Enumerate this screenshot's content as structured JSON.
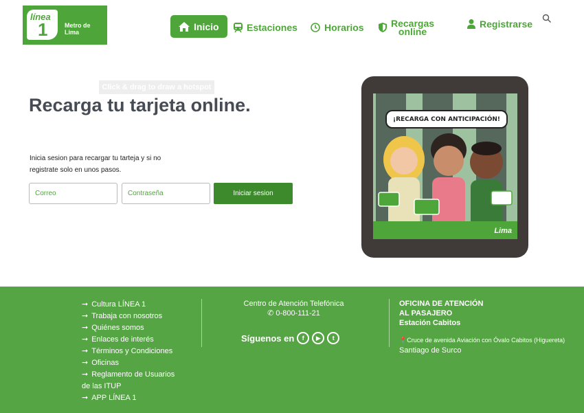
{
  "logo": {
    "linea": "línea",
    "number": "1",
    "metro": "Metro de Lima"
  },
  "nav": {
    "inicio": "Inicio",
    "estaciones": "Estaciones",
    "horarios": "Horarios",
    "recargas_line1": "Recargas",
    "recargas_line2": "online",
    "registrarse": "Registrarse"
  },
  "hotspot_tip": "Click & drag to draw a hotspot",
  "main": {
    "title": "Recarga tu tarjeta online.",
    "description": "Inicia sesion para recargar tu tarteja y si no registrate solo en unos pasos.",
    "email_placeholder": "Correo",
    "password_placeholder": "Contraseña",
    "login_button": "Iniciar sesion"
  },
  "promo": {
    "banner": "¡RECARGA CON ANTICIPACIÓN!",
    "brand": "Lima"
  },
  "footer": {
    "links": [
      "Cultura LÍNEA 1",
      "Trabaja con nosotros",
      "Quiénes somos",
      "Enlaces de interés",
      "Términos y Condiciones",
      "Oficinas",
      "Reglamento de Usuarios de las ITUP",
      "APP LÍNEA 1"
    ],
    "call_center_title": "Centro de Atención Telefónica",
    "phone": "0-800-111-21",
    "follow_label": "Síguenos en",
    "office_line1": "OFICINA DE ATENCIÓN",
    "office_line2": "AL PASAJERO",
    "office_station": "Estación Cabitos",
    "address": "Cruce de avenida Aviación con Óvalo Cabitos (Higuereta)",
    "city": "Santiago de Surco"
  },
  "colors": {
    "brand_green": "#4ea63a",
    "dark_green": "#3d8a2c",
    "footer_green": "#56a544",
    "title_gray": "#464b54"
  }
}
